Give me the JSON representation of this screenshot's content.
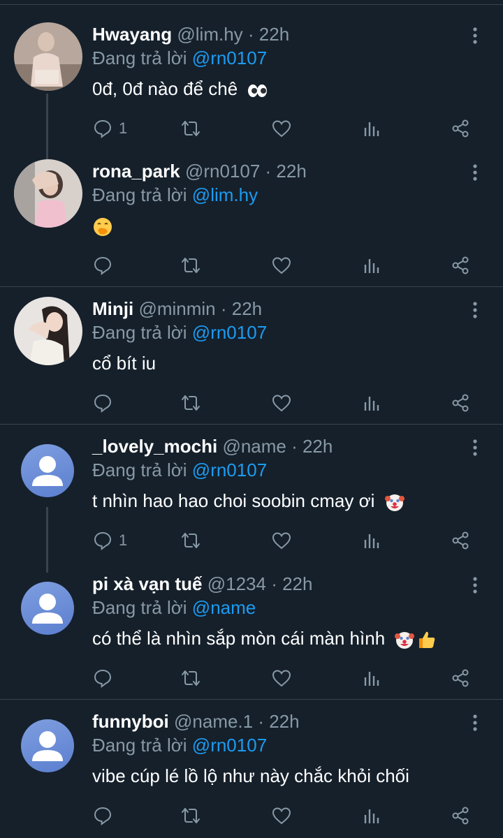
{
  "tweets": [
    {
      "name": "Hwayang",
      "handle": "@lim.hy · 22h",
      "reply_prefix": "Đang trả lời",
      "reply_to": "@rn0107",
      "text": "0đ, 0đ nào để chê",
      "emoji": "eyes-emoji",
      "reply_count": "1",
      "avatar": "photo"
    },
    {
      "name": "rona_park",
      "handle": "@rn0107 · 22h",
      "reply_prefix": "Đang trả lời",
      "reply_to": "@lim.hy",
      "text": "",
      "emoji": "face-with-hand-over-mouth-emoji",
      "reply_count": "",
      "avatar": "photo"
    },
    {
      "name": "Minji",
      "handle": "@minmin · 22h",
      "reply_prefix": "Đang trả lời",
      "reply_to": "@rn0107",
      "text": "cổ bít iu",
      "emoji": "",
      "reply_count": "",
      "avatar": "photo"
    },
    {
      "name": "_lovely_mochi",
      "handle": "@name · 22h",
      "reply_prefix": "Đang trả lời",
      "reply_to": "@rn0107",
      "text": "t nhìn hao hao choi soobin cmay ơi",
      "emoji": "clown-emoji",
      "reply_count": "1",
      "avatar": "default"
    },
    {
      "name": "pi xà vạn tuế",
      "handle": "@1234 · 22h",
      "reply_prefix": "Đang trả lời",
      "reply_to": "@name",
      "text": "có thể là nhìn sắp mòn cái màn hình",
      "emoji": "clown-thumbsup-emoji",
      "reply_count": "",
      "avatar": "default"
    },
    {
      "name": "funnyboi",
      "handle": "@name.1 · 22h",
      "reply_prefix": "Đang trả lời",
      "reply_to": "@rn0107",
      "text": "vibe cúp lé lồ lộ như này chắc khỏi chối",
      "emoji": "",
      "reply_count": "",
      "avatar": "default"
    }
  ],
  "colors": {
    "background": "#15202b",
    "secondary_text": "#8899a6",
    "mention": "#1d9bf0",
    "divider": "#38444d"
  }
}
